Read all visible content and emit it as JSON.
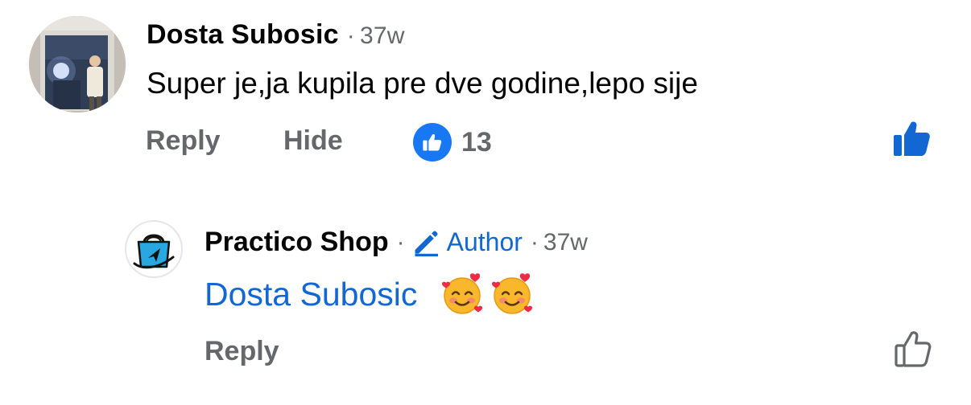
{
  "comment": {
    "author": "Dosta Subosic",
    "separator": "·",
    "time": "37w",
    "text": "Super je,ja kupila pre dve godine,lepo sije",
    "actions": {
      "reply": "Reply",
      "hide": "Hide"
    },
    "reaction_count": "13",
    "reaction_icon": "thumbs-up-badge-icon",
    "like_icon": "thumbs-up-filled-icon"
  },
  "reply": {
    "author": "Practico Shop",
    "separator": "·",
    "badge_icon": "pencil-icon",
    "badge_label": "Author",
    "separator2": "·",
    "time": "37w",
    "mention": "Dosta Subosic",
    "emojis": [
      "smiling-face-with-hearts-icon",
      "smiling-face-with-hearts-icon"
    ],
    "actions": {
      "reply": "Reply"
    },
    "like_icon": "thumbs-up-outline-icon"
  },
  "colors": {
    "primary_text": "#050505",
    "secondary_text": "#65676b",
    "link_blue": "#1267d3",
    "reaction_blue": "#1877f2"
  }
}
